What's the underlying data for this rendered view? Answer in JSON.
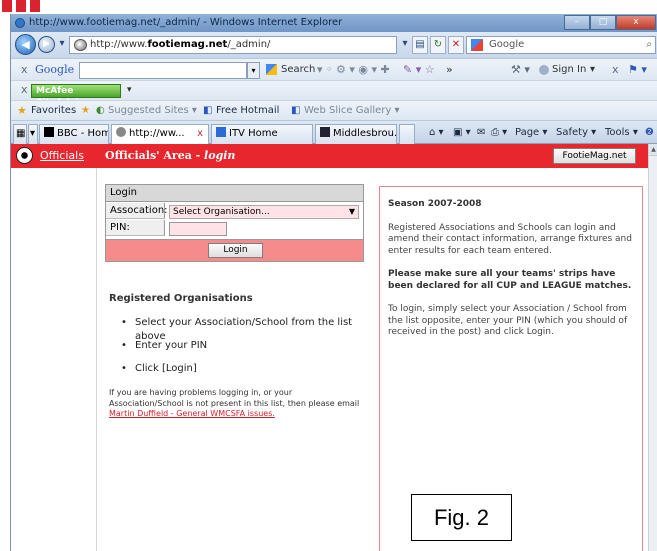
{
  "browser": {
    "title": "http://www.footiemag.net/_admin/ - Windows Internet Explorer",
    "address_prefix": "http://www.",
    "address_domain": "footiemag.net",
    "address_suffix": "/_admin/",
    "search_placeholder": "Google",
    "window_buttons": [
      "–",
      "□",
      "x"
    ]
  },
  "google_toolbar": {
    "close": "x",
    "logo": "Google",
    "search_label": "Search",
    "more": "»",
    "sign_in": "Sign In",
    "close2": "x"
  },
  "mcafee": {
    "close": "x",
    "badge": "McAfee SiteAdvisor"
  },
  "favorites_bar": {
    "favorites": "Favorites",
    "items": [
      "Suggested Sites ▾",
      "Free Hotmail",
      "Web Slice Gallery ▾"
    ]
  },
  "tabs": {
    "items": [
      "BBC - Home...",
      "http://ww...",
      "ITV Home",
      "Middlesbrou..."
    ],
    "close": "x",
    "commands": [
      "Page ▾",
      "Safety ▾",
      "Tools ▾"
    ]
  },
  "site": {
    "header_link": "Officials",
    "area_title": "Officials' Area - ",
    "area_sub": "login",
    "header_button": "FootieMag.net"
  },
  "login": {
    "heading": "Login",
    "assoc_label": "Assocation:",
    "assoc_value": "Select Organisation...",
    "pin_label": "PIN:",
    "button": "Login"
  },
  "registered": {
    "title": "Registered Organisations",
    "steps": [
      "Select your Association/School from the list above",
      "Enter your PIN",
      "Click [Login]"
    ],
    "help_text": "If you are having problems logging in, or your Association/School is not present in this list, then please email ",
    "help_link": "Martin Duffield - General WMCSFA issues."
  },
  "season": {
    "title": "Season 2007-2008",
    "para1": "Registered Associations and Schools can login and amend their contact information, arrange fixtures and enter results for each team entered.",
    "para2": "Please make sure all your teams' strips have been declared for all CUP and LEAGUE matches.",
    "para3": "To login, simply select your Association / School from the list opposite, enter your PIN (which you should of received in the post) and click Login."
  },
  "figure_label": "Fig. 2",
  "colors": {
    "site_red": "#e8262e",
    "login_footer": "#f58b8b",
    "select_bg": "#ffe3e6"
  }
}
